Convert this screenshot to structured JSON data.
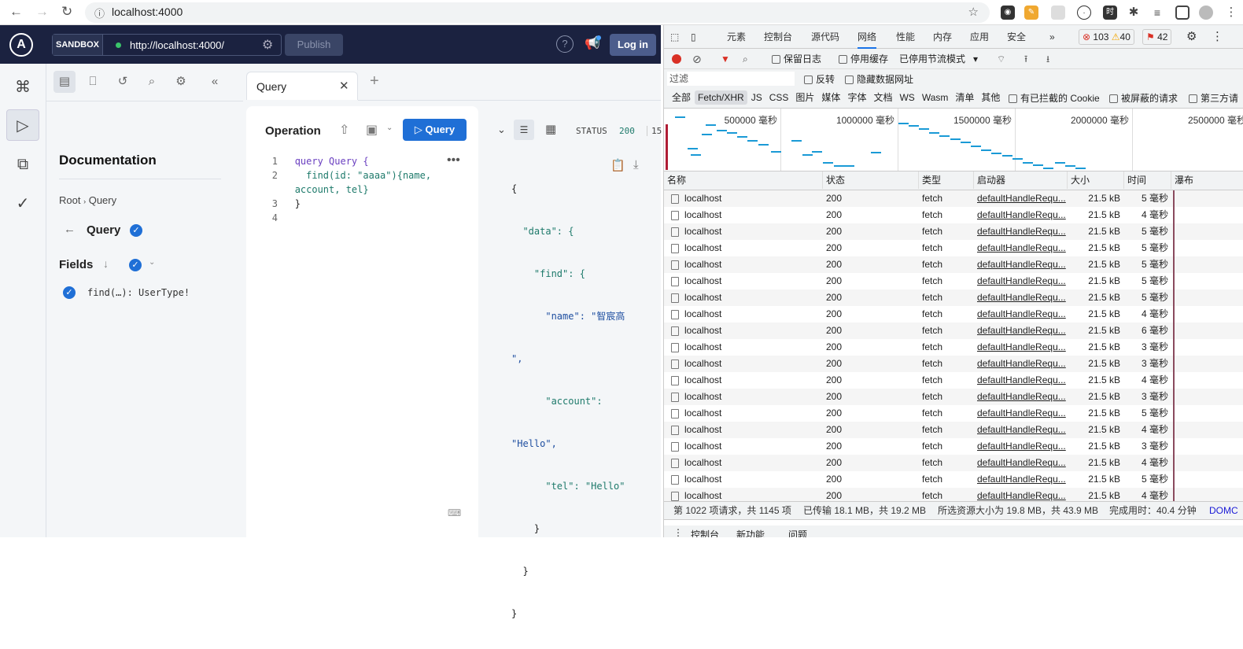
{
  "browser": {
    "url": "localhost:4000"
  },
  "apollo": {
    "sandbox_label": "SANDBOX",
    "endpoint": "http://localhost:4000/",
    "publish": "Publish",
    "login": "Log in",
    "doc_title": "Documentation",
    "breadcrumb": [
      "Root",
      "Query"
    ],
    "type_title": "Query",
    "fields_label": "Fields",
    "field": "find(…)",
    "field_type": "UserType!",
    "tab": "Query",
    "operation_label": "Operation",
    "run_label": "Query",
    "code_lines": [
      {
        "n": "1",
        "text": "query Query {"
      },
      {
        "n": "2",
        "text": "  find(id: \"aaaa\"){name,"
      },
      {
        "n": "",
        "text": "account, tel}"
      },
      {
        "n": "3",
        "text": "}"
      },
      {
        "n": "4",
        "text": ""
      }
    ],
    "status_label": "STATUS",
    "status_code": "200",
    "status_extra": "15",
    "response_lines": [
      "{",
      "  \"data\": {",
      "    \"find\": {",
      "      \"name\": \"智宸高",
      "\",",
      "      \"account\":",
      "\"Hello\",",
      "      \"tel\": \"Hello\"",
      "    }",
      "  }",
      "}"
    ]
  },
  "devtools": {
    "tabs": [
      "元素",
      "控制台",
      "源代码",
      "网络",
      "性能",
      "内存",
      "应用",
      "安全",
      "»"
    ],
    "active_tab": "网络",
    "errors": "103",
    "warnings": "40",
    "issues": "42",
    "toolbar": {
      "preserve_log": "保留日志",
      "disable_cache": "停用缓存",
      "throttle": "已停用节流模式"
    },
    "filter_placeholder": "过滤",
    "invert": "反转",
    "hide_data_urls": "隐藏数据网址",
    "type_filters": [
      "全部",
      "Fetch/XHR",
      "JS",
      "CSS",
      "图片",
      "媒体",
      "字体",
      "文档",
      "WS",
      "Wasm",
      "清单",
      "其他"
    ],
    "active_type": "Fetch/XHR",
    "blocked_cookies": "有已拦截的 Cookie",
    "blocked_requests": "被屏蔽的请求",
    "third_party": "第三方请",
    "timeline_ticks": [
      "500000 毫秒",
      "1000000 毫秒",
      "1500000 毫秒",
      "2000000 毫秒",
      "2500000 毫秒"
    ],
    "columns": [
      "名称",
      "状态",
      "类型",
      "启动器",
      "大小",
      "时间",
      "瀑布"
    ],
    "rows": [
      {
        "name": "localhost",
        "status": "200",
        "type": "fetch",
        "initiator": "defaultHandleRequ...",
        "size": "21.5 kB",
        "time": "5 毫秒"
      },
      {
        "name": "localhost",
        "status": "200",
        "type": "fetch",
        "initiator": "defaultHandleRequ...",
        "size": "21.5 kB",
        "time": "4 毫秒"
      },
      {
        "name": "localhost",
        "status": "200",
        "type": "fetch",
        "initiator": "defaultHandleRequ...",
        "size": "21.5 kB",
        "time": "5 毫秒"
      },
      {
        "name": "localhost",
        "status": "200",
        "type": "fetch",
        "initiator": "defaultHandleRequ...",
        "size": "21.5 kB",
        "time": "5 毫秒"
      },
      {
        "name": "localhost",
        "status": "200",
        "type": "fetch",
        "initiator": "defaultHandleRequ...",
        "size": "21.5 kB",
        "time": "5 毫秒"
      },
      {
        "name": "localhost",
        "status": "200",
        "type": "fetch",
        "initiator": "defaultHandleRequ...",
        "size": "21.5 kB",
        "time": "5 毫秒"
      },
      {
        "name": "localhost",
        "status": "200",
        "type": "fetch",
        "initiator": "defaultHandleRequ...",
        "size": "21.5 kB",
        "time": "5 毫秒"
      },
      {
        "name": "localhost",
        "status": "200",
        "type": "fetch",
        "initiator": "defaultHandleRequ...",
        "size": "21.5 kB",
        "time": "4 毫秒"
      },
      {
        "name": "localhost",
        "status": "200",
        "type": "fetch",
        "initiator": "defaultHandleRequ...",
        "size": "21.5 kB",
        "time": "6 毫秒"
      },
      {
        "name": "localhost",
        "status": "200",
        "type": "fetch",
        "initiator": "defaultHandleRequ...",
        "size": "21.5 kB",
        "time": "3 毫秒"
      },
      {
        "name": "localhost",
        "status": "200",
        "type": "fetch",
        "initiator": "defaultHandleRequ...",
        "size": "21.5 kB",
        "time": "3 毫秒"
      },
      {
        "name": "localhost",
        "status": "200",
        "type": "fetch",
        "initiator": "defaultHandleRequ...",
        "size": "21.5 kB",
        "time": "4 毫秒"
      },
      {
        "name": "localhost",
        "status": "200",
        "type": "fetch",
        "initiator": "defaultHandleRequ...",
        "size": "21.5 kB",
        "time": "3 毫秒"
      },
      {
        "name": "localhost",
        "status": "200",
        "type": "fetch",
        "initiator": "defaultHandleRequ...",
        "size": "21.5 kB",
        "time": "5 毫秒"
      },
      {
        "name": "localhost",
        "status": "200",
        "type": "fetch",
        "initiator": "defaultHandleRequ...",
        "size": "21.5 kB",
        "time": "4 毫秒"
      },
      {
        "name": "localhost",
        "status": "200",
        "type": "fetch",
        "initiator": "defaultHandleRequ...",
        "size": "21.5 kB",
        "time": "3 毫秒"
      },
      {
        "name": "localhost",
        "status": "200",
        "type": "fetch",
        "initiator": "defaultHandleRequ...",
        "size": "21.5 kB",
        "time": "4 毫秒"
      },
      {
        "name": "localhost",
        "status": "200",
        "type": "fetch",
        "initiator": "defaultHandleRequ...",
        "size": "21.5 kB",
        "time": "5 毫秒"
      },
      {
        "name": "localhost",
        "status": "200",
        "type": "fetch",
        "initiator": "defaultHandleRequ...",
        "size": "21.5 kB",
        "time": "4 毫秒"
      }
    ],
    "statusbar": [
      "第 1022 项请求，共 1145 项",
      "已传输 18.1 MB，共 19.2 MB",
      "所选资源大小为 19.8 MB，共 43.9 MB",
      "完成用时：40.4 分钟",
      "DOMC"
    ],
    "drawer_tabs": [
      "控制台",
      "新功能",
      "问题"
    ]
  }
}
